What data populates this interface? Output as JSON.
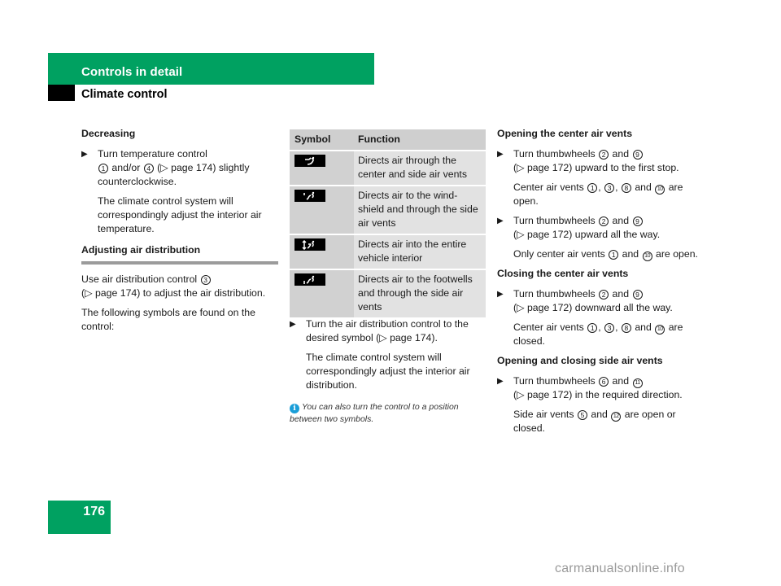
{
  "header": {
    "section_title": "Controls in detail",
    "subsection_title": "Climate control"
  },
  "page_number": "176",
  "colors": {
    "brand_green": "#00a161",
    "info_blue": "#1a9ed8"
  },
  "col1": {
    "decreasing_heading": "Decreasing",
    "step1": {
      "arrow": "▶",
      "text_a": "Turn temperature control",
      "num1": "1",
      "text_b": "and/or",
      "num2": "4",
      "text_c": "(▷ page 174) slightly counterclockwise."
    },
    "step1_result": "The climate control system will correspondingly adjust the interior air temperature.",
    "adjust_heading": "Adjusting air distribution",
    "use_text_a": "Use air distribution control",
    "use_num": "3",
    "use_text_b": "(▷ page 174) to adjust the air distribution.",
    "symbols_intro": "The following symbols are found on the control:"
  },
  "table": {
    "headers": {
      "symbol": "Symbol",
      "function": "Function"
    },
    "rows": [
      {
        "icon": "air-center-side-vents-icon",
        "function": "Directs air through the center and side air vents"
      },
      {
        "icon": "air-windshield-side-vents-icon",
        "function": "Directs air to the wind-shield and through the side air vents"
      },
      {
        "icon": "air-entire-interior-icon",
        "function": "Directs air into the entire vehicle interior"
      },
      {
        "icon": "air-footwells-side-vents-icon",
        "function": "Directs air to the footwells and through the side air vents"
      }
    ]
  },
  "col2": {
    "step": {
      "arrow": "▶",
      "text": "Turn the air distribution control to the desired symbol (▷ page 174)."
    },
    "step_result": "The climate control system will correspondingly adjust the interior air distribution.",
    "note": {
      "icon": "i",
      "text": "You can also turn the control to a position between two symbols."
    }
  },
  "col3": {
    "open_center_heading": "Opening the center air vents",
    "open_step1": {
      "text_a": "Turn thumbwheels",
      "n1": "2",
      "and": "and",
      "n2": "9",
      "text_b": "(▷ page 172) upward to the first stop."
    },
    "open_step1_result": {
      "text_a": "Center air vents",
      "n1": "1",
      "n2": "3",
      "n3": "8",
      "and": "and",
      "n4": "10",
      "text_b": "are open."
    },
    "open_step2": {
      "text_a": "Turn thumbwheels",
      "n1": "2",
      "and": "and",
      "n2": "9",
      "text_b": "(▷ page 172) upward all the way."
    },
    "open_step2_result": {
      "text_a": "Only center air vents",
      "n1": "1",
      "and": "and",
      "n2": "10",
      "text_b": "are open."
    },
    "close_center_heading": "Closing the center air vents",
    "close_step": {
      "text_a": "Turn thumbwheels",
      "n1": "2",
      "and": "and",
      "n2": "9",
      "text_b": "(▷ page 172) downward all the way."
    },
    "close_step_result": {
      "text_a": "Center air vents",
      "n1": "1",
      "n2": "3",
      "n3": "8",
      "and": "and",
      "n4": "10",
      "text_b": "are closed."
    },
    "side_heading": "Opening and closing side air vents",
    "side_step": {
      "text_a": "Turn thumbwheels",
      "n1": "6",
      "and": "and",
      "n2": "11",
      "text_b": "(▷ page 172) in the required direction."
    },
    "side_step_result": {
      "text_a": "Side air vents",
      "n1": "5",
      "and": "and",
      "n2": "12",
      "text_b": "are open or closed."
    }
  },
  "watermark": "carmanualsonline.info"
}
